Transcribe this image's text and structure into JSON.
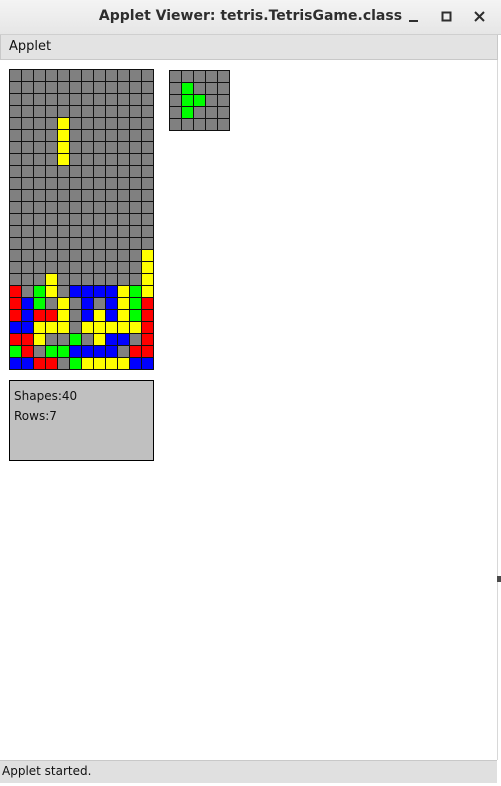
{
  "window": {
    "title": "Applet Viewer: tetris.TetrisGame.class",
    "buttons": [
      "minimize",
      "maximize",
      "close"
    ]
  },
  "menubar": {
    "items": [
      "Applet"
    ]
  },
  "colors": {
    "G": "#808080",
    "Y": "#ffff00",
    "R": "#ff0000",
    "B": "#0000ff",
    "N": "#00ff00",
    "grid": "#111111",
    "info_background": "#c0c0c0"
  },
  "board": {
    "columns": 12,
    "rows": 25,
    "cells": [
      "GGGGGGGGGGGG",
      "GGGGGGGGGGGG",
      "GGGGGGGGGGGG",
      "GGGGGGGGGGGG",
      "GGGGYGGGGGGG",
      "GGGGYGGGGGGG",
      "GGGGYGGGGGGG",
      "GGGGYGGGGGGG",
      "GGGGGGGGGGGG",
      "GGGGGGGGGGGG",
      "GGGGGGGGGGGG",
      "GGGGGGGGGGGG",
      "GGGGGGGGGGGG",
      "GGGGGGGGGGGG",
      "GGGGGGGGGGGG",
      "GGGGGGGGGGGY",
      "GGGGGGGGGGGY",
      "GGGYGGGGGGGY",
      "RGNYGBBBBYNY",
      "RBNGYGBGBYNR",
      "RBRRYGBYBYNR",
      "BBYYYGYYYYYR",
      "RRYGGNGYBBGR",
      "NRGNNBBBBGRR",
      "BBRRGNYYYYBB"
    ]
  },
  "next_piece": {
    "columns": 5,
    "rows": 5,
    "cells": [
      "GGGGG",
      "GNGGG",
      "GNNGG",
      "GNGGG",
      "GGGGG"
    ]
  },
  "stats": {
    "shapes_label": "Shapes:",
    "shapes": "40",
    "rows_label": "Rows:",
    "rows": "7"
  },
  "status": "Applet started."
}
